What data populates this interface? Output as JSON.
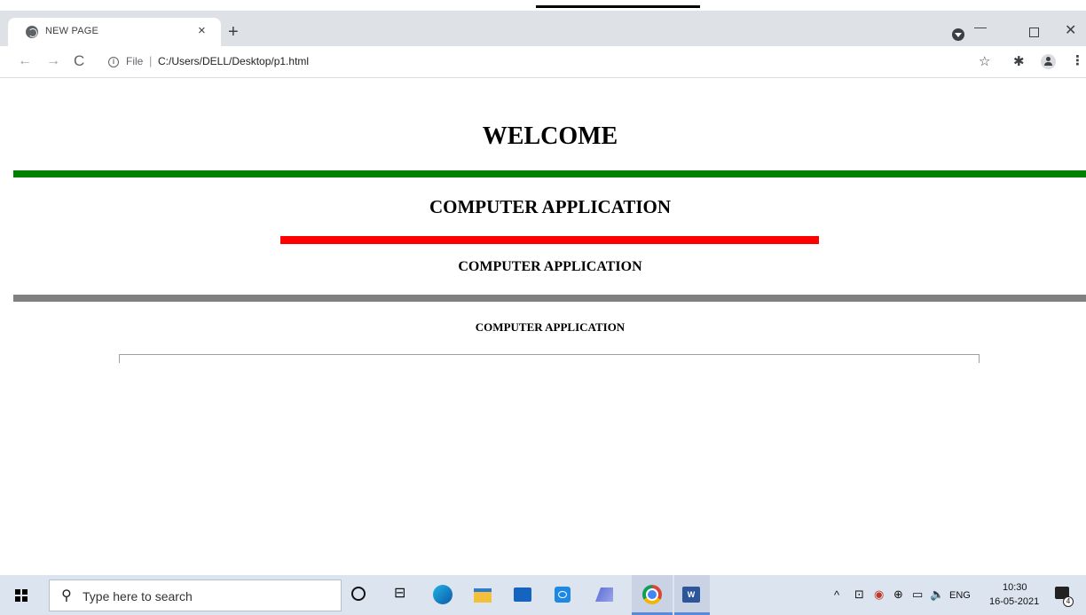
{
  "browser": {
    "tab": {
      "title": "NEW PAGE",
      "close": "×"
    },
    "new_tab": "+",
    "window_controls": {
      "minimize": "—",
      "close": "✕"
    },
    "nav": {
      "back": "←",
      "forward": "→",
      "reload": "C"
    },
    "address": {
      "scheme": "File",
      "separator": "|",
      "path": "C:/Users/DELL/Desktop/p1.html"
    },
    "icons": {
      "info": "i",
      "star": "☆",
      "extensions": "✱",
      "menu": "⋮"
    }
  },
  "page": {
    "heading1": "WELCOME",
    "heading2": "COMPUTER APPLICATION",
    "heading3": "COMPUTER APPLICATION",
    "heading4": "COMPUTER APPLICATION",
    "rules": {
      "green": "#008000",
      "red": "#ff0000",
      "gray": "#808080"
    }
  },
  "taskbar": {
    "search_placeholder": "Type here to search",
    "search_icon": "⚲",
    "taskview_icon": "⊟",
    "word_label": "W",
    "tray": {
      "up": "^",
      "lang": "ENG",
      "speaker": "🔈",
      "notifications_count": "4"
    },
    "clock": {
      "time": "10:30",
      "date": "16-05-2021"
    }
  }
}
